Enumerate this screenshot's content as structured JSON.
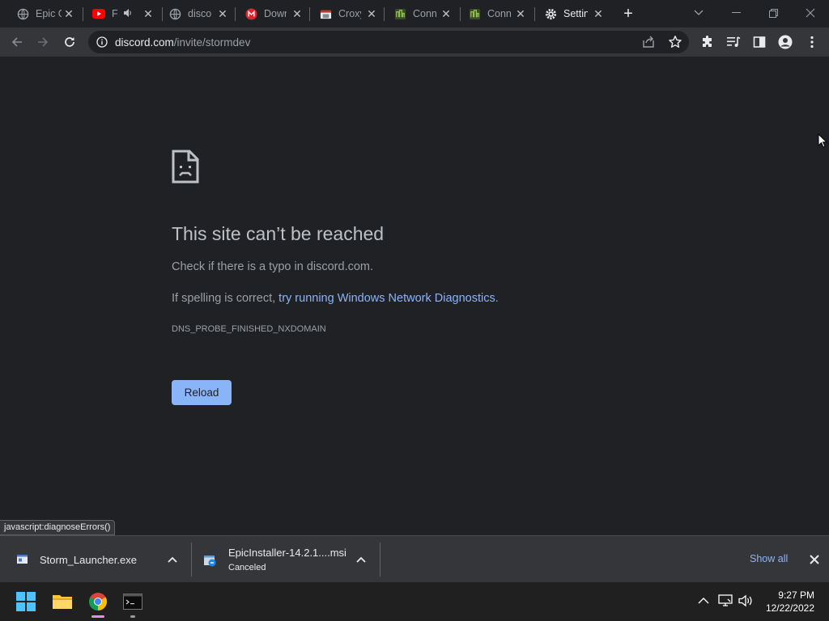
{
  "tabs": [
    {
      "title": "Epic Games",
      "favicon": "globe-icon"
    },
    {
      "title": "FORTNITE",
      "favicon": "youtube-icon",
      "audio": true
    },
    {
      "title": "discord.com",
      "favicon": "globe-icon"
    },
    {
      "title": "Download",
      "favicon": "mega-icon"
    },
    {
      "title": "Croxy Proxy",
      "favicon": "croxy-icon"
    },
    {
      "title": "Connect",
      "favicon": "connect-icon"
    },
    {
      "title": "Connect",
      "favicon": "connect-icon"
    },
    {
      "title": "Settings",
      "favicon": "gear-icon"
    }
  ],
  "address_bar": {
    "host": "discord.com",
    "path": "/invite/stormdev"
  },
  "error_page": {
    "title": "This site can’t be reached",
    "line1": "Check if there is a typo in discord.com.",
    "line2_prefix": "If spelling is correct, ",
    "line2_link": "try running Windows Network Diagnostics",
    "line2_suffix": ".",
    "error_code": "DNS_PROBE_FINISHED_NXDOMAIN",
    "reload_label": "Reload"
  },
  "status_bubble": "javascript:diagnoseErrors()",
  "downloads": [
    {
      "name": "Storm_Launcher.exe",
      "status": ""
    },
    {
      "name": "EpicInstaller-14.2.1....msi",
      "status": "Canceled"
    }
  ],
  "shelf": {
    "show_all_label": "Show all"
  },
  "taskbar": {
    "time": "9:27 PM",
    "date": "12/22/2022"
  },
  "colors": {
    "link": "#8ab4f8",
    "page_bg": "#202124",
    "toolbar_bg": "#35363a"
  }
}
